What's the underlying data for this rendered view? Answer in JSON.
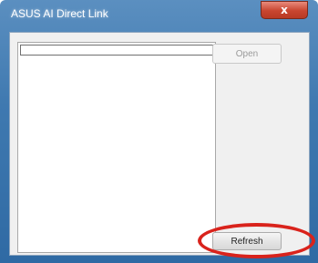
{
  "window": {
    "title": "ASUS AI Direct Link",
    "close_glyph": "x"
  },
  "main": {
    "open_label": "Open",
    "refresh_label": "Refresh"
  },
  "colors": {
    "title_bar": "#3f79b0",
    "close_button": "#c8452f",
    "highlight": "#d9231c"
  }
}
